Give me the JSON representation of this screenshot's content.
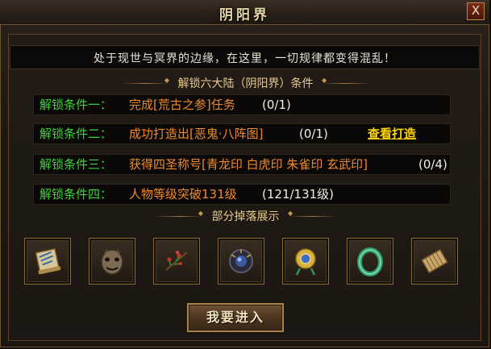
{
  "window": {
    "title": "阴阳界",
    "close_label": "X"
  },
  "description": "处于现世与冥界的边缘，在这里，一切规律都变得混乱！",
  "unlock_section": {
    "title": "解锁六大陆（阴阳界）条件"
  },
  "conditions": [
    {
      "label": "解锁条件一：",
      "text": "完成[荒古之参]任务",
      "progress": "(0/1)"
    },
    {
      "label": "解锁条件二：",
      "text": "成功打造出[恶鬼·八阵图]",
      "progress": "(0/1)",
      "link": "查看打造"
    },
    {
      "label": "解锁条件三：",
      "text": "获得四圣称号[青龙印 白虎印 朱雀印 玄武印]",
      "progress": "(0/4)"
    },
    {
      "label": "解锁条件四：",
      "text": "人物等级突破131级",
      "progress": "(121/131级)"
    }
  ],
  "drops_section": {
    "title": "部分掉落展示"
  },
  "drop_items": [
    {
      "icon": "scroll-map-icon"
    },
    {
      "icon": "demon-mask-icon"
    },
    {
      "icon": "herb-branch-icon"
    },
    {
      "icon": "dark-orb-icon"
    },
    {
      "icon": "gold-amulet-icon"
    },
    {
      "icon": "jade-ring-icon"
    },
    {
      "icon": "bamboo-scroll-icon"
    }
  ],
  "enter_button": "我要进入",
  "colors": {
    "condition_label": "#3ed33a",
    "condition_text": "#ef8a2a",
    "link": "#ffd400",
    "frame": "#6d5430"
  }
}
